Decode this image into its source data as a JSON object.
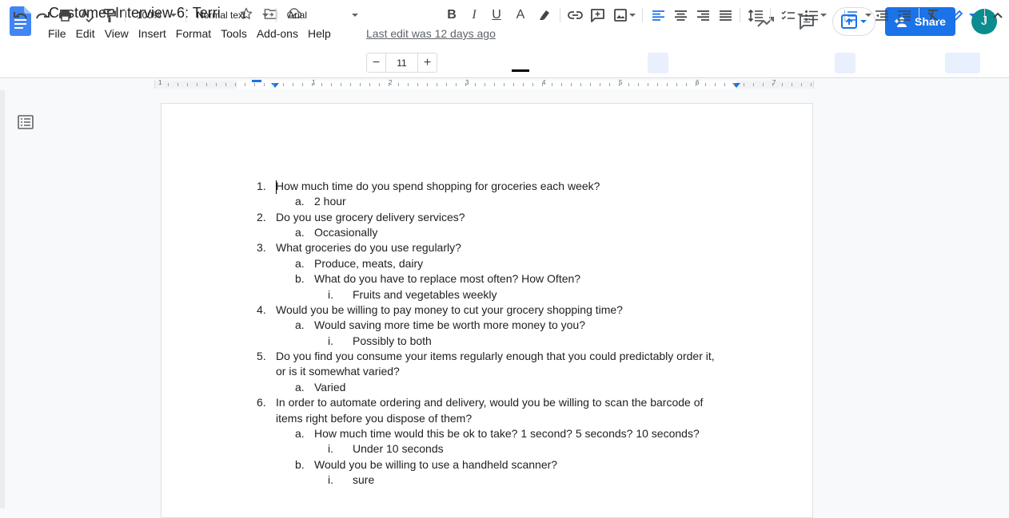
{
  "app": {
    "doc_title": "Customer Interview 6: Terri",
    "last_edit": "Last edit was 12 days ago",
    "share_label": "Share",
    "avatar_initial": "J",
    "brand_color": "#1a73e8",
    "avatar_color": "#0b8c8f"
  },
  "menu": [
    "File",
    "Edit",
    "View",
    "Insert",
    "Format",
    "Tools",
    "Add-ons",
    "Help"
  ],
  "toolbar": {
    "zoom": "100%",
    "style": "Normal text",
    "font": "Arial",
    "font_size": "11",
    "minus": "−",
    "plus": "+",
    "bold": "B",
    "italic": "I",
    "underline": "U",
    "text_color": "A"
  },
  "ruler": {
    "numbers": [
      "1",
      "1",
      "2",
      "3",
      "4",
      "5",
      "6",
      "7"
    ]
  },
  "document": {
    "lines": [
      {
        "marker": "1.",
        "text": "How much time do you spend shopping for groceries each week?"
      },
      {
        "marker": "a.",
        "text": "2 hour"
      },
      {
        "marker": "2.",
        "text": "Do you use grocery delivery services?"
      },
      {
        "marker": "a.",
        "text": "Occasionally"
      },
      {
        "marker": "3.",
        "text": "What groceries do you use regularly?"
      },
      {
        "marker": "a.",
        "text": "Produce, meats, dairy"
      },
      {
        "marker": "b.",
        "text": "What do you have to replace most often? How Often?"
      },
      {
        "marker": "i.",
        "text": "Fruits and vegetables weekly"
      },
      {
        "marker": "4.",
        "text": "Would you be willing to pay money to cut your grocery shopping time?"
      },
      {
        "marker": "a.",
        "text": "Would saving more time be worth more money to you?"
      },
      {
        "marker": "i.",
        "text": "Possibly to both"
      },
      {
        "marker": "5.",
        "text": "Do you find you consume your items regularly enough that you could predictably order it,"
      },
      {
        "marker": "",
        "text": "or is it somewhat varied?"
      },
      {
        "marker": "a.",
        "text": "Varied"
      },
      {
        "marker": "6.",
        "text": "In order to automate ordering and delivery, would you be willing to scan the barcode of"
      },
      {
        "marker": "",
        "text": "items right before you dispose of them?"
      },
      {
        "marker": "a.",
        "text": "How much time would this be ok to take? 1 second? 5 seconds? 10 seconds?"
      },
      {
        "marker": "i.",
        "text": "Under 10 seconds"
      },
      {
        "marker": "b.",
        "text": "Would you be willing to use a handheld scanner?"
      },
      {
        "marker": "i.",
        "text": "sure"
      }
    ]
  }
}
